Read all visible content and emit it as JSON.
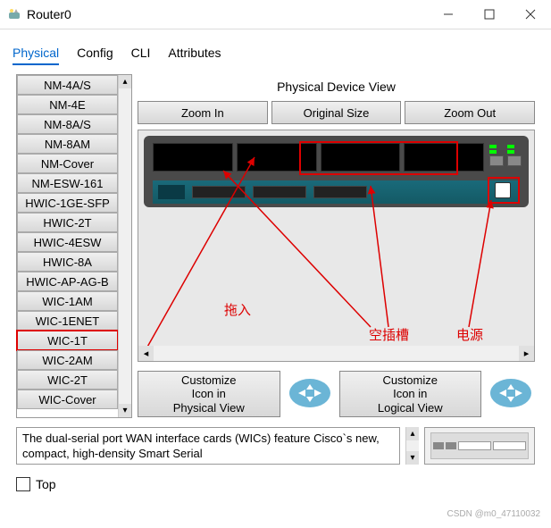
{
  "window": {
    "title": "Router0"
  },
  "tabs": [
    "Physical",
    "Config",
    "CLI",
    "Attributes"
  ],
  "active_tab": 0,
  "modules_list": [
    "NM-4A/S",
    "NM-4E",
    "NM-8A/S",
    "NM-8AM",
    "NM-Cover",
    "NM-ESW-161",
    "HWIC-1GE-SFP",
    "HWIC-2T",
    "HWIC-4ESW",
    "HWIC-8A",
    "HWIC-AP-AG-B",
    "WIC-1AM",
    "WIC-1ENET",
    "WIC-1T",
    "WIC-2AM",
    "WIC-2T",
    "WIC-Cover"
  ],
  "highlighted_module_index": 13,
  "view": {
    "title": "Physical Device View",
    "zoom_in": "Zoom In",
    "original": "Original Size",
    "zoom_out": "Zoom Out"
  },
  "annotations": {
    "drag_in": "拖入",
    "empty_slot": "空插槽",
    "power": "电源"
  },
  "customize": {
    "physical_line1": "Customize",
    "physical_line2": "Icon in",
    "physical_line3": "Physical View",
    "logical_line1": "Customize",
    "logical_line2": "Icon in",
    "logical_line3": "Logical View"
  },
  "description": "The dual-serial port WAN interface cards (WICs) feature Cisco`s new, compact, high-density Smart Serial",
  "footer": {
    "top_label": "Top",
    "top_checked": false
  },
  "watermark": "CSDN @m0_47110032",
  "colors": {
    "accent": "#0066cc",
    "highlight": "#d00"
  }
}
